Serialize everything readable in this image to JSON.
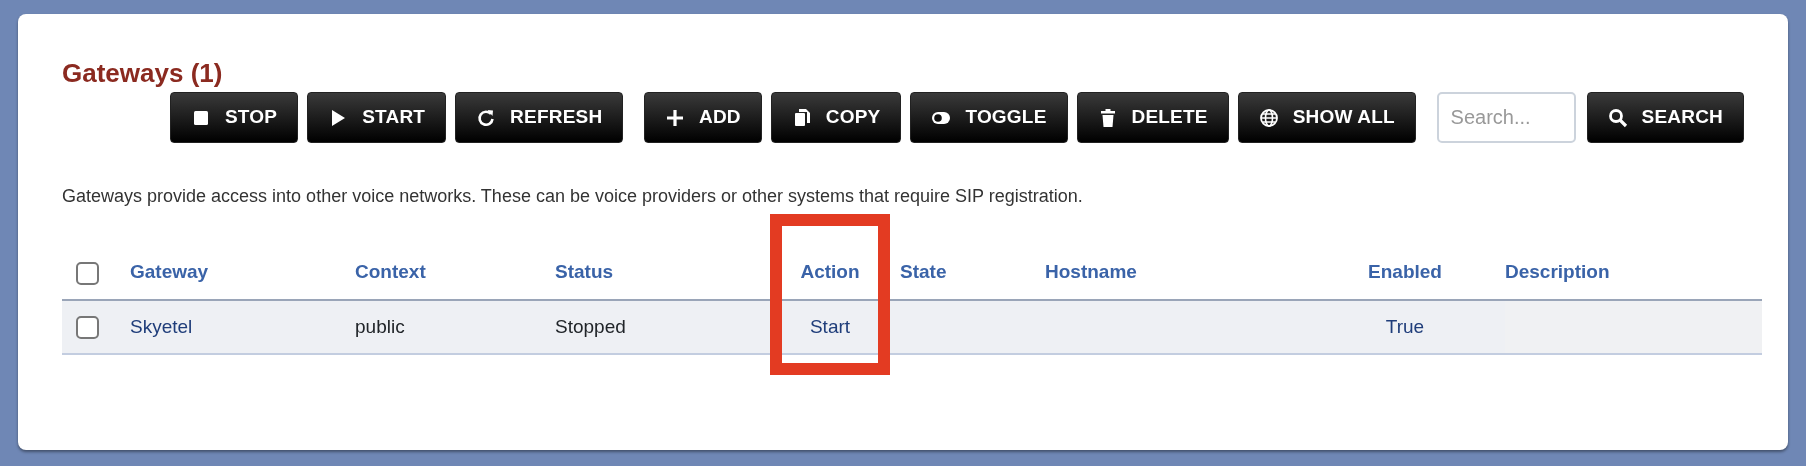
{
  "title": "Gateways (1)",
  "toolbar": [
    {
      "kind": "button",
      "label": "STOP"
    },
    {
      "kind": "button",
      "label": "START"
    },
    {
      "kind": "button",
      "label": "REFRESH"
    },
    {
      "kind": "gap"
    },
    {
      "kind": "button",
      "label": "ADD"
    },
    {
      "kind": "button",
      "label": "COPY"
    },
    {
      "kind": "button",
      "label": "TOGGLE"
    },
    {
      "kind": "button",
      "label": "DELETE"
    },
    {
      "kind": "button",
      "label": "SHOW ALL"
    },
    {
      "kind": "gap"
    },
    {
      "kind": "search",
      "placeholder": "Search..."
    },
    {
      "kind": "button",
      "label": "SEARCH"
    }
  ],
  "description": "Gateways provide access into other voice networks. These can be voice providers or other systems that require SIP registration.",
  "table": {
    "select_all": {
      "checked": false
    },
    "columns": [
      {
        "label": "Gateway",
        "highlighted": false
      },
      {
        "label": "Context",
        "highlighted": false
      },
      {
        "label": "Status",
        "highlighted": false
      },
      {
        "label": "Action",
        "highlighted": true
      },
      {
        "label": "State",
        "highlighted": false
      },
      {
        "label": "Hostname",
        "highlighted": false
      },
      {
        "label": "Enabled",
        "highlighted": false
      },
      {
        "label": "Description",
        "highlighted": false
      }
    ],
    "rows": [
      {
        "checked": false,
        "cells": [
          {
            "text": "Skyetel",
            "kind": "link"
          },
          {
            "text": "public",
            "kind": "text"
          },
          {
            "text": "Stopped",
            "kind": "text"
          },
          {
            "text": "Start",
            "kind": "link"
          },
          null,
          null,
          {
            "text": "True",
            "kind": "link"
          },
          null
        ]
      }
    ]
  }
}
